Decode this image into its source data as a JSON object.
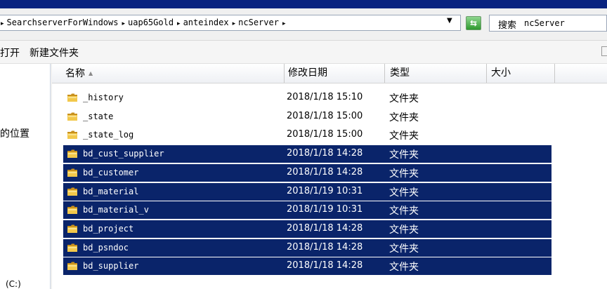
{
  "address": {
    "crumbs": [
      "SearchserverForWindows",
      "uap65Gold",
      "anteindex",
      "ncServer"
    ],
    "leading_arrow": "▸",
    "dropdown_glyph": "▼"
  },
  "search": {
    "label": "搜索",
    "scope": "ncServer"
  },
  "toolbar": {
    "open_label": "打开",
    "new_folder_label": "新建文件夹"
  },
  "nav": {
    "location_label": "的位置",
    "drive_label": "(C:)"
  },
  "columns": {
    "name": "名称",
    "date": "修改日期",
    "type": "类型",
    "size": "大小"
  },
  "files": [
    {
      "name": "_history",
      "modified": "2018/1/18 15:10",
      "type": "文件夹",
      "selected": false
    },
    {
      "name": "_state",
      "modified": "2018/1/18 15:00",
      "type": "文件夹",
      "selected": false
    },
    {
      "name": "_state_log",
      "modified": "2018/1/18 15:00",
      "type": "文件夹",
      "selected": false
    },
    {
      "name": "bd_cust_supplier",
      "modified": "2018/1/18 14:28",
      "type": "文件夹",
      "selected": true
    },
    {
      "name": "bd_customer",
      "modified": "2018/1/18 14:28",
      "type": "文件夹",
      "selected": true
    },
    {
      "name": "bd_material",
      "modified": "2018/1/19 10:31",
      "type": "文件夹",
      "selected": true
    },
    {
      "name": "bd_material_v",
      "modified": "2018/1/19 10:31",
      "type": "文件夹",
      "selected": true
    },
    {
      "name": "bd_project",
      "modified": "2018/1/18 14:28",
      "type": "文件夹",
      "selected": true
    },
    {
      "name": "bd_psndoc",
      "modified": "2018/1/18 14:28",
      "type": "文件夹",
      "selected": true
    },
    {
      "name": "bd_supplier",
      "modified": "2018/1/18 14:28",
      "type": "文件夹",
      "selected": true
    }
  ],
  "colors": {
    "selection": "#0a246a",
    "folder": "#e8b73a",
    "title_bar": "#0a2480"
  },
  "icons": {
    "folder": "folder-icon",
    "refresh": "refresh-icon",
    "sort": "sort-ascending-icon"
  }
}
